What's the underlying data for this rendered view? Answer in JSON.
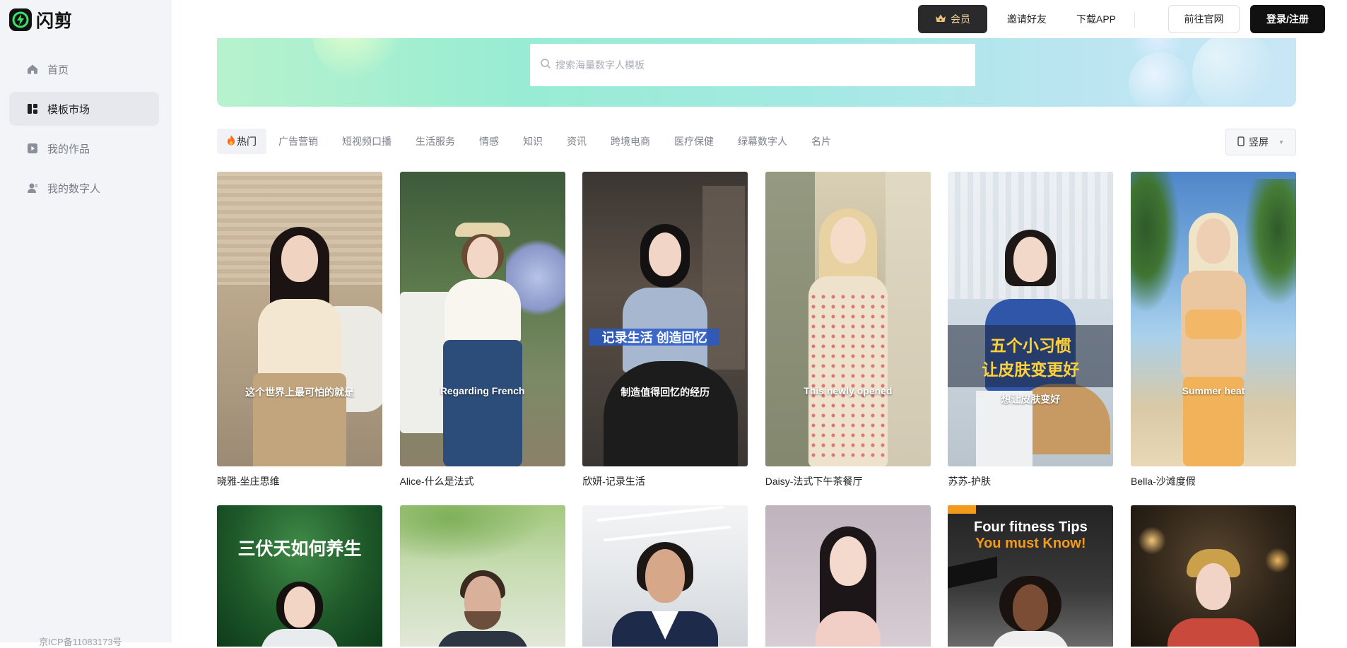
{
  "app": {
    "name": "闪剪"
  },
  "sidebar": {
    "items": [
      {
        "label": "首页",
        "icon": "home-icon"
      },
      {
        "label": "模板市场",
        "icon": "template-grid-icon",
        "active": true
      },
      {
        "label": "我的作品",
        "icon": "play-square-icon"
      },
      {
        "label": "我的数字人",
        "icon": "user-icon"
      }
    ],
    "icp": "京ICP备11083173号"
  },
  "header": {
    "vip_label": "会员",
    "invite_label": "邀请好友",
    "download_label": "下载APP",
    "official_label": "前往官网",
    "login_label": "登录/注册"
  },
  "search": {
    "placeholder": "搜索海量数字人模板"
  },
  "tabs": [
    {
      "label": "热门",
      "active": true
    },
    {
      "label": "广告营销"
    },
    {
      "label": "短视频口播"
    },
    {
      "label": "生活服务"
    },
    {
      "label": "情感"
    },
    {
      "label": "知识"
    },
    {
      "label": "资讯"
    },
    {
      "label": "跨境电商"
    },
    {
      "label": "医疗保健"
    },
    {
      "label": "绿幕数字人"
    },
    {
      "label": "名片"
    }
  ],
  "orientation": {
    "label": "竖屏"
  },
  "templates_row1": [
    {
      "title": "晓雅-坐庄思维",
      "caption": "这个世界上最可怕的就是"
    },
    {
      "title": "Alice-什么是法式",
      "caption": "Regarding French"
    },
    {
      "title": "欣妍-记录生活",
      "caption": "制造值得回忆的经历",
      "band": "记录生活 创造回忆"
    },
    {
      "title": "Daisy-法式下午茶餐厅",
      "caption": "This newly opened"
    },
    {
      "title": "苏苏-护肤",
      "caption": "想让皮肤变好",
      "band": "五个小习惯",
      "band2": "让皮肤变更好"
    },
    {
      "title": "Bella-沙滩度假",
      "caption": "Summer heat"
    }
  ],
  "templates_row2": [
    {
      "band": "三伏天如何养生"
    },
    {},
    {},
    {},
    {
      "band": "Four fitness Tips",
      "band2": "You must Know!"
    },
    {}
  ]
}
